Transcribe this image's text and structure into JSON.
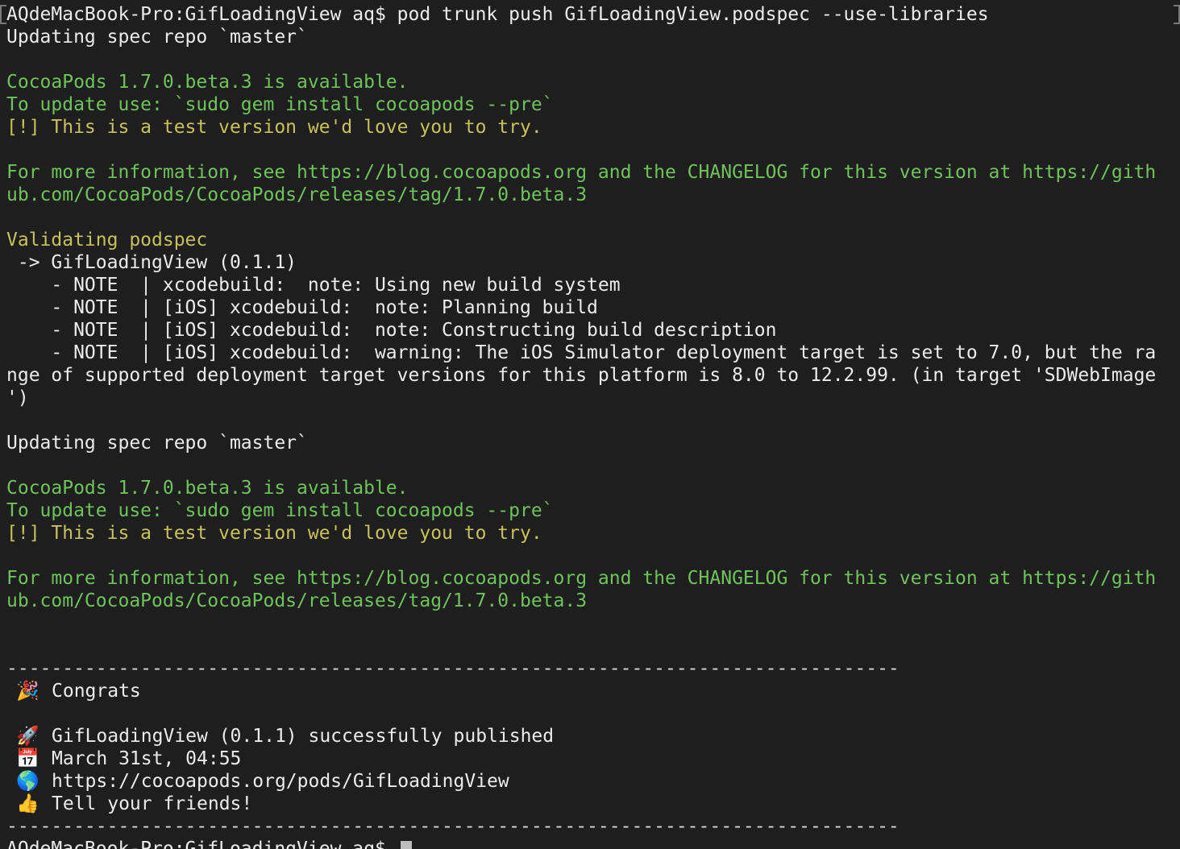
{
  "terminal": {
    "lines": [
      {
        "text": "AQdeMacBook-Pro:GifLoadingView aq$ pod trunk push GifLoadingView.podspec --use-libraries",
        "color": "white"
      },
      {
        "text": "Updating spec repo `master`",
        "color": "white"
      },
      {
        "text": "",
        "color": "white"
      },
      {
        "text": "CocoaPods 1.7.0.beta.3 is available.",
        "color": "green"
      },
      {
        "text": "To update use: `sudo gem install cocoapods --pre`",
        "color": "green"
      },
      {
        "text": "[!] This is a test version we'd love you to try.",
        "color": "yellow"
      },
      {
        "text": "",
        "color": "white"
      },
      {
        "text": "For more information, see https://blog.cocoapods.org and the CHANGELOG for this version at https://gith",
        "color": "green"
      },
      {
        "text": "ub.com/CocoaPods/CocoaPods/releases/tag/1.7.0.beta.3",
        "color": "green"
      },
      {
        "text": "",
        "color": "white"
      },
      {
        "text": "Validating podspec",
        "color": "yellow"
      },
      {
        "text": " -> GifLoadingView (0.1.1)",
        "color": "white"
      },
      {
        "text": "    - NOTE  | xcodebuild:  note: Using new build system",
        "color": "white"
      },
      {
        "text": "    - NOTE  | [iOS] xcodebuild:  note: Planning build",
        "color": "white"
      },
      {
        "text": "    - NOTE  | [iOS] xcodebuild:  note: Constructing build description",
        "color": "white"
      },
      {
        "text": "    - NOTE  | [iOS] xcodebuild:  warning: The iOS Simulator deployment target is set to 7.0, but the ra",
        "color": "white"
      },
      {
        "text": "nge of supported deployment target versions for this platform is 8.0 to 12.2.99. (in target 'SDWebImage",
        "color": "white"
      },
      {
        "text": "')",
        "color": "white"
      },
      {
        "text": "",
        "color": "white"
      },
      {
        "text": "Updating spec repo `master`",
        "color": "white"
      },
      {
        "text": "",
        "color": "white"
      },
      {
        "text": "CocoaPods 1.7.0.beta.3 is available.",
        "color": "green"
      },
      {
        "text": "To update use: `sudo gem install cocoapods --pre`",
        "color": "green"
      },
      {
        "text": "[!] This is a test version we'd love you to try.",
        "color": "yellow"
      },
      {
        "text": "",
        "color": "white"
      },
      {
        "text": "For more information, see https://blog.cocoapods.org and the CHANGELOG for this version at https://gith",
        "color": "green"
      },
      {
        "text": "ub.com/CocoaPods/CocoaPods/releases/tag/1.7.0.beta.3",
        "color": "green"
      },
      {
        "text": "",
        "color": "white"
      },
      {
        "text": "",
        "color": "white"
      }
    ],
    "separator": "--------------------------------------------------------------------------------",
    "congrats": {
      "party_icon": "🎉",
      "title": "Congrats",
      "rocket_icon": "🚀",
      "published": "GifLoadingView (0.1.1) successfully published",
      "calendar_icon": "📅",
      "date": "March 31st, 04:55",
      "globe_icon": "🌎",
      "url": "https://cocoapods.org/pods/GifLoadingView",
      "thumbs_icon": "👍",
      "friends": "Tell your friends!"
    },
    "prompt": "AQdeMacBook-Pro:GifLoadingView aq$ "
  },
  "colors": {
    "background": "#1e1e1e",
    "white": "#ebebeb",
    "green": "#6ec35a",
    "yellow": "#c8c05a"
  }
}
